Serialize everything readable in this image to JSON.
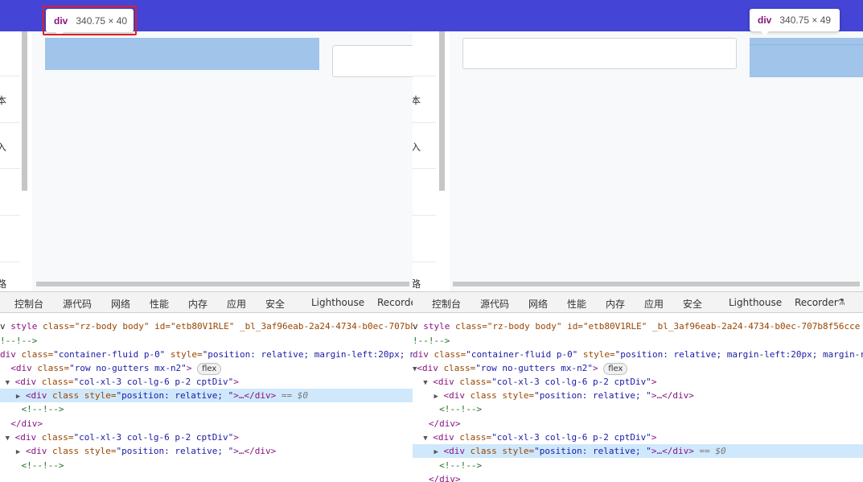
{
  "left": {
    "tooltip": {
      "tag": "div",
      "dims": "340.75 × 40"
    },
    "sidebar_glyphs": [
      "本",
      "入",
      "路"
    ],
    "devtools_tabs": [
      "控制台",
      "源代码",
      "网络",
      "性能",
      "内存",
      "应用",
      "安全",
      "Lighthouse",
      "Recorde"
    ],
    "dom": {
      "l1_a": "v ",
      "l1_tag": "style",
      "l1_b": " class=\"rz-body body\" id=\"etb80V1RLE\" _bl_3af96eab-2a24-4734-b0ec-707b8",
      "l2": "!--!-->",
      "l3_tag": "div",
      "l3_an": " class=",
      "l3_av": "\"container-fluid p-0\"",
      "l3_an2": " style=",
      "l3_av2": "\"position: relative; margin-left:20px; ma",
      "l4_tag": "<div",
      "l4_an": " class=",
      "l4_av": "\"row no-gutters mx-n2\"",
      "l4_end": ">",
      "l4_badge": "flex",
      "l5_tag": "<div",
      "l5_an": " class=",
      "l5_av": "\"col-xl-3 col-lg-6 p-2 cptDiv\"",
      "l5_end": ">",
      "l6_tag": "<div",
      "l6_an": " class style=",
      "l6_av": "\"position: relative; \"",
      "l6_end": ">…</div>",
      "l6_eq": " == $0",
      "l7": "<!--!-->",
      "l8": "</div>",
      "l9_tag": "<div",
      "l9_an": " class=",
      "l9_av": "\"col-xl-3 col-lg-6 p-2 cptDiv\"",
      "l9_end": ">",
      "l10_tag": "<div",
      "l10_an": " class style=",
      "l10_av": "\"position: relative; \"",
      "l10_end": ">…</div>",
      "l11": "<!--!-->"
    }
  },
  "right": {
    "tooltip": {
      "tag": "div",
      "dims": "340.75 × 49"
    },
    "sidebar_glyphs": [
      "本",
      "入",
      "路"
    ],
    "devtools_tabs": [
      "控制台",
      "源代码",
      "网络",
      "性能",
      "内存",
      "应用",
      "安全",
      "Lighthouse",
      "Recorder"
    ],
    "dom": {
      "l1_a": "v ",
      "l1_tag": "style",
      "l1_b": " class=\"rz-body body\" id=\"etb80V1RLE\" _bl_3af96eab-2a24-4734-b0ec-707b8f56cce",
      "l2": "!--!-->",
      "l3_tag": "div",
      "l3_an": " class=",
      "l3_av": "\"container-fluid p-0\"",
      "l3_an2": " style=",
      "l3_av2": "\"position: relative; margin-left:20px; margin-r",
      "l4_tag": "<div",
      "l4_an": " class=",
      "l4_av": "\"row no-gutters mx-n2\"",
      "l4_end": ">",
      "l4_badge": "flex",
      "l5_tag": "<div",
      "l5_an": " class=",
      "l5_av": "\"col-xl-3 col-lg-6 p-2 cptDiv\"",
      "l5_end": ">",
      "l6_tag": "<div",
      "l6_an": " class style=",
      "l6_av": "\"position: relative; \"",
      "l6_end": ">…</div>",
      "l7": "<!--!-->",
      "l8": "</div>",
      "l9_tag": "<div",
      "l9_an": " class=",
      "l9_av": "\"col-xl-3 col-lg-6 p-2 cptDiv\"",
      "l9_end": ">",
      "l10_tag": "<div",
      "l10_an": " class style=",
      "l10_av": "\"position: relative; \"",
      "l10_end": ">…</div>",
      "l10_eq": " == $0",
      "l11": "<!--!-->",
      "l12": "</div>"
    }
  },
  "colors": {
    "topbar": "#4444d6",
    "highlight": "#a0c4ea",
    "selected_row": "#cfe8fc",
    "red_frame": "#e02020",
    "tag": "#881280"
  }
}
